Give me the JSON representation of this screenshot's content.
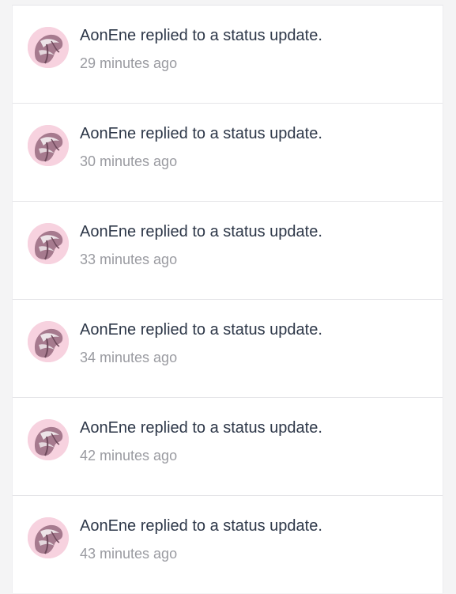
{
  "feed": {
    "items": [
      {
        "user": "AonEne",
        "action": "replied to a status update.",
        "time": "29 minutes ago",
        "avatar_icon": "user-avatar-pink-hair"
      },
      {
        "user": "AonEne",
        "action": "replied to a status update.",
        "time": "30 minutes ago",
        "avatar_icon": "user-avatar-pink-hair"
      },
      {
        "user": "AonEne",
        "action": "replied to a status update.",
        "time": "33 minutes ago",
        "avatar_icon": "user-avatar-pink-hair"
      },
      {
        "user": "AonEne",
        "action": "replied to a status update.",
        "time": "34 minutes ago",
        "avatar_icon": "user-avatar-pink-hair"
      },
      {
        "user": "AonEne",
        "action": "replied to a status update.",
        "time": "42 minutes ago",
        "avatar_icon": "user-avatar-pink-hair"
      },
      {
        "user": "AonEne",
        "action": "replied to a status update.",
        "time": "43 minutes ago",
        "avatar_icon": "user-avatar-pink-hair"
      }
    ],
    "colors": {
      "avatar_bg": "#f7d2df",
      "title_text": "#2d3748",
      "time_text": "#9a9ba1"
    }
  }
}
